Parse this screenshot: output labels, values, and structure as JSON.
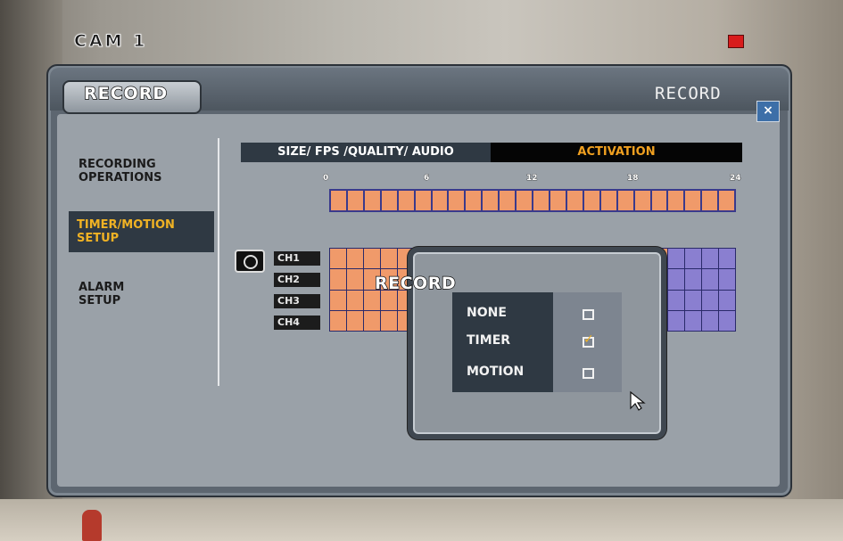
{
  "camera": {
    "label": "CAM 1"
  },
  "header": {
    "tab_label": "RECORD",
    "title": "RECORD",
    "close_icon": "×"
  },
  "menu": {
    "items": [
      {
        "line1": "RECORDING",
        "line2": "OPERATIONS",
        "selected": false
      },
      {
        "line1": "TIMER/MOTION",
        "line2": "SETUP",
        "selected": true
      },
      {
        "line1": "ALARM",
        "line2": "SETUP",
        "selected": false
      }
    ]
  },
  "tabs": [
    {
      "label": "SIZE/ FPS /QUALITY/ AUDIO",
      "active": false
    },
    {
      "label": "ACTIVATION",
      "active": true
    }
  ],
  "timeline": {
    "hour_labels": [
      "0",
      "6",
      "12",
      "18",
      "24"
    ]
  },
  "channels": [
    "CH1",
    "CH2",
    "CH3",
    "CH4"
  ],
  "popup": {
    "title": "RECORD",
    "options": [
      {
        "label": "NONE",
        "checked": false
      },
      {
        "label": "TIMER",
        "checked": true
      },
      {
        "label": "MOTION",
        "checked": false
      }
    ]
  },
  "colors": {
    "selected_text": "#f0b224",
    "timer_cell": "#f09a6a",
    "motion_cell": "#8a7fd0",
    "recording_indicator": "#d81c1c"
  }
}
